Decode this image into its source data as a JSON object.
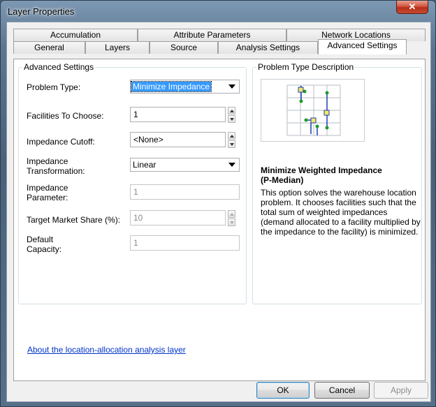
{
  "window": {
    "title": "Layer Properties",
    "close_glyph": "✕"
  },
  "tabs_row1": [
    {
      "label": "Accumulation"
    },
    {
      "label": "Attribute Parameters"
    },
    {
      "label": "Network Locations"
    }
  ],
  "tabs_row2": [
    {
      "label": "General"
    },
    {
      "label": "Layers"
    },
    {
      "label": "Source"
    },
    {
      "label": "Analysis Settings"
    },
    {
      "label": "Advanced Settings",
      "active": true
    }
  ],
  "advanced": {
    "group_title": "Advanced Settings",
    "problem_type": {
      "label": "Problem Type:",
      "value": "Minimize Impedance"
    },
    "facilities": {
      "label": "Facilities To Choose:",
      "value": "1"
    },
    "cutoff": {
      "label": "Impedance Cutoff:",
      "value": "<None>"
    },
    "transformation": {
      "label": "Impedance Transformation:",
      "value": "Linear"
    },
    "parameter": {
      "label": "Impedance Parameter:",
      "value": "1"
    },
    "market_share": {
      "label": "Target Market Share (%):",
      "value": "10"
    },
    "capacity": {
      "label": "Default Capacity:",
      "value": "1"
    }
  },
  "description": {
    "group_title": "Problem Type Description",
    "heading": "Minimize Weighted Impedance (P-Median)",
    "body": "This option solves the warehouse location problem. It chooses facilities such that the total sum of weighted impedances (demand allocated to a facility multiplied by the impedance to the facility) is minimized."
  },
  "help_link": "About the location-allocation analysis layer",
  "buttons": {
    "ok": "OK",
    "cancel": "Cancel",
    "apply": "Apply"
  },
  "colors": {
    "link": "#0033cc",
    "selection": "#3399ff",
    "facility": "#f5e663",
    "demand": "#1f9a2a",
    "route": "#1a3fb5"
  }
}
